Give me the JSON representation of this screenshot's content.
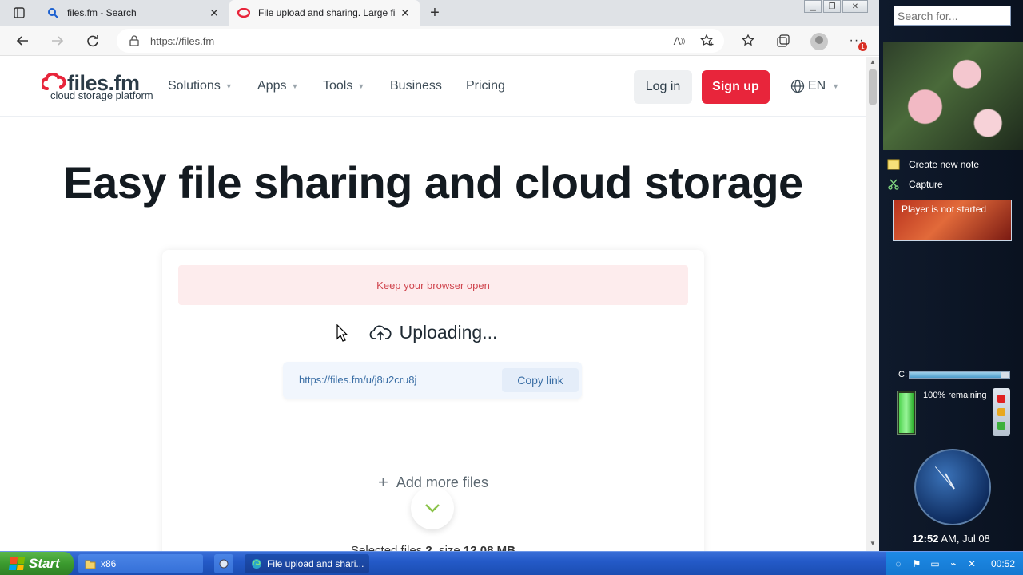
{
  "browser": {
    "tabs": [
      {
        "title": "files.fm - Search",
        "active": false
      },
      {
        "title": "File upload and sharing. Large fi",
        "active": true
      }
    ],
    "address": "https://files.fm",
    "notification_count": "1"
  },
  "site": {
    "logo_main": "files.fm",
    "logo_sub": "cloud storage platform",
    "nav": [
      {
        "label": "Solutions",
        "dropdown": true
      },
      {
        "label": "Apps",
        "dropdown": true
      },
      {
        "label": "Tools",
        "dropdown": true
      },
      {
        "label": "Business",
        "dropdown": false
      },
      {
        "label": "Pricing",
        "dropdown": false
      }
    ],
    "login_label": "Log in",
    "signup_label": "Sign up",
    "language": "EN",
    "accent_color": "#e8253b"
  },
  "main": {
    "headline": "Easy file sharing and cloud storage",
    "notice": "Keep your browser open",
    "status": "Uploading...",
    "share_url": "https://files.fm/u/j8u2cru8j",
    "copy_label": "Copy link",
    "add_more_label": "Add more files",
    "selected_prefix": "Selected files",
    "selected_count": "2",
    "size_prefix": ", size",
    "selected_size": "12.08 MB"
  },
  "sidebar": {
    "search_placeholder": "Search for...",
    "note_label": "Create new note",
    "capture_label": "Capture",
    "player_status": "Player is not started",
    "drive_label": "C:",
    "drive_fill": 0.92,
    "battery_text": "100% remaining",
    "battery_level": 1.0,
    "clock_time": "12:52",
    "clock_rest": " AM, Jul 08"
  },
  "taskbar": {
    "start_label": "Start",
    "tasks": [
      {
        "label": "x86"
      },
      {
        "label": ""
      },
      {
        "label": "File upload and shari..."
      }
    ],
    "tray_time": "00:52"
  }
}
